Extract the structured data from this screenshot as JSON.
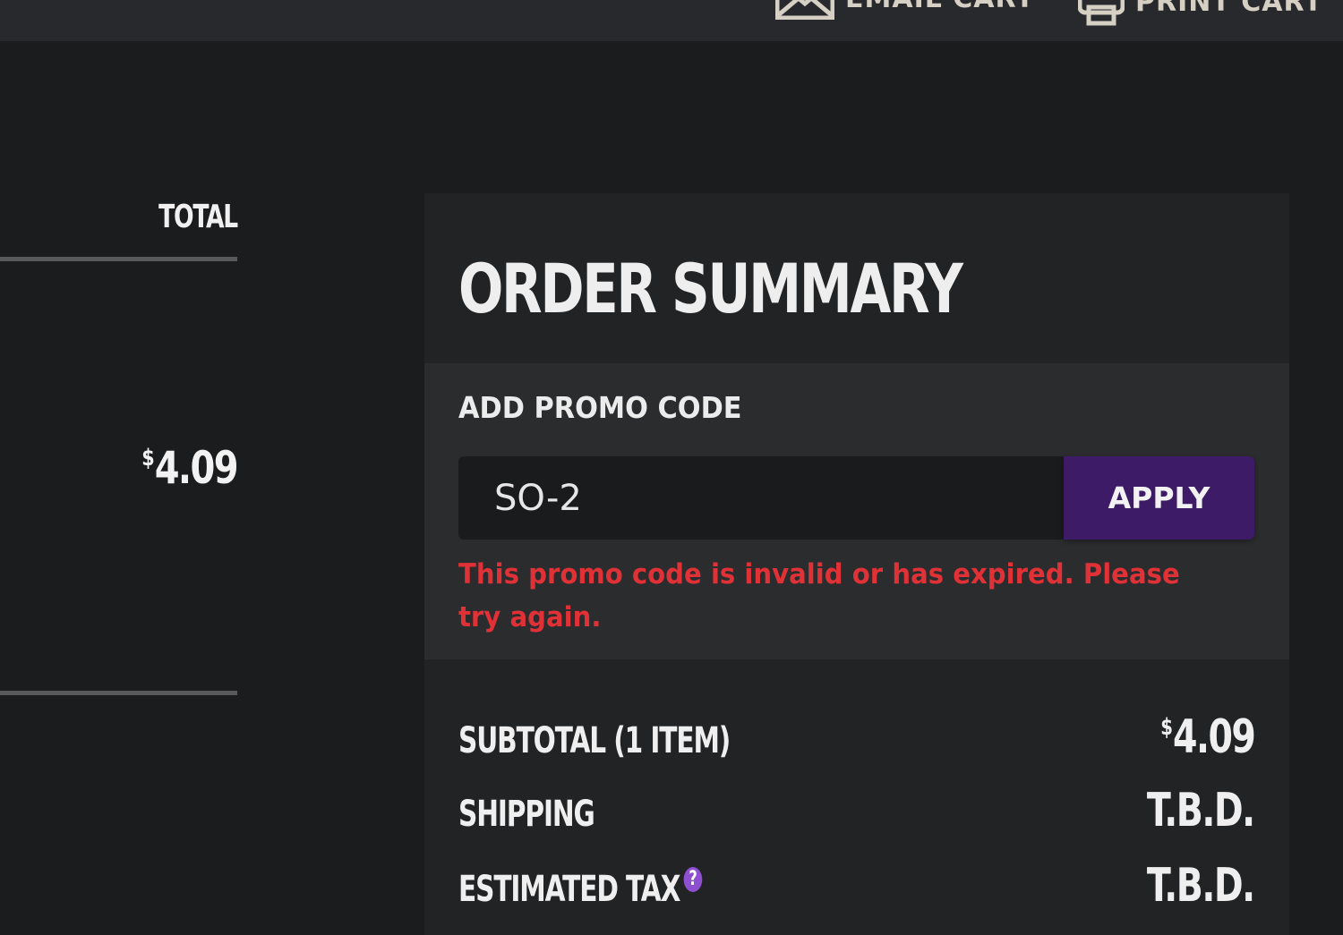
{
  "header": {
    "email_cart_label": "EMAIL CART",
    "print_cart_label": "PRINT CART"
  },
  "cart": {
    "total_header": "TOTAL",
    "line_total_currency": "$",
    "line_total_amount": "4.09"
  },
  "order_summary": {
    "title": "ORDER SUMMARY",
    "promo": {
      "label": "ADD PROMO CODE",
      "input_value": "SO-2",
      "apply_label": "APPLY",
      "error": "This promo code is invalid or has expired. Please try again."
    },
    "rows": {
      "subtotal_label": "SUBTOTAL (1 ITEM)",
      "subtotal_currency": "$",
      "subtotal_amount": "4.09",
      "shipping_label": "SHIPPING",
      "shipping_value": "T.B.D.",
      "tax_label": "ESTIMATED TAX",
      "tax_help_glyph": "?",
      "tax_value": "T.B.D."
    }
  },
  "colors": {
    "background": "#1b1c1e",
    "panel": "#222325",
    "promo_panel": "#2a2c2e",
    "apply_button": "#3d1b66",
    "error_text": "#e03137",
    "help_icon": "#8e4fd0"
  }
}
